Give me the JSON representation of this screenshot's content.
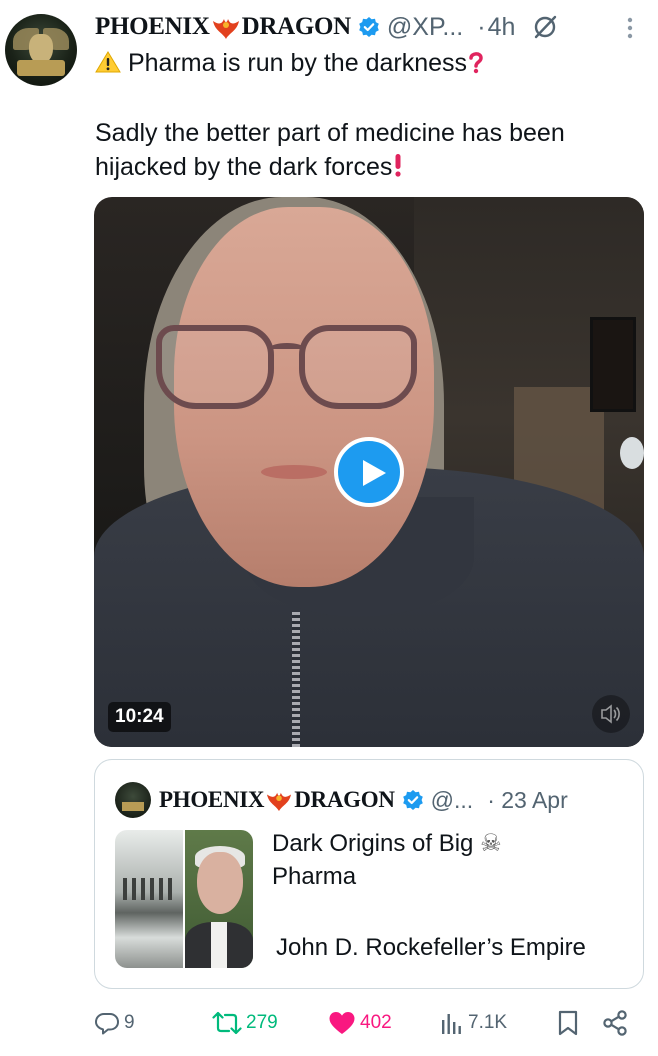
{
  "tweet": {
    "display_name_part1": "PHOENIX",
    "display_name_part2": "DRAGON",
    "handle": "@XP...",
    "separator": "·",
    "time": "4h",
    "line1": "Pharma is run by the darkness",
    "line2": "Sadly the better part of medicine has been hijacked by the dark forces",
    "warning_emoji": "⚠️",
    "question_emoji": "❓",
    "exclaim_emoji": "❗"
  },
  "video": {
    "duration": "10:24",
    "play_icon": "play-icon",
    "mute_icon": "speaker-muted-icon"
  },
  "quote": {
    "display_name_part1": "PHOENIX",
    "display_name_part2": "DRAGON",
    "handle": "@...",
    "separator": "·",
    "date": "23 Apr",
    "text_line1": "Dark Origins of Big",
    "text_line2": "Pharma",
    "text_line3": "John D. Rockefeller’s Empire",
    "skull_emoji": "☠"
  },
  "actions": {
    "replies": "9",
    "retweets": "279",
    "likes": "402",
    "views": "7.1K",
    "reply_icon": "reply-icon",
    "retweet_icon": "retweet-icon",
    "like_icon": "heart-icon",
    "views_icon": "views-icon",
    "bookmark_icon": "bookmark-icon",
    "share_icon": "share-icon"
  },
  "colors": {
    "accent": "#1d9bf0",
    "retweet": "#00ba7c",
    "like": "#f91880",
    "muted_text": "#536471",
    "border": "#cfd9de"
  }
}
